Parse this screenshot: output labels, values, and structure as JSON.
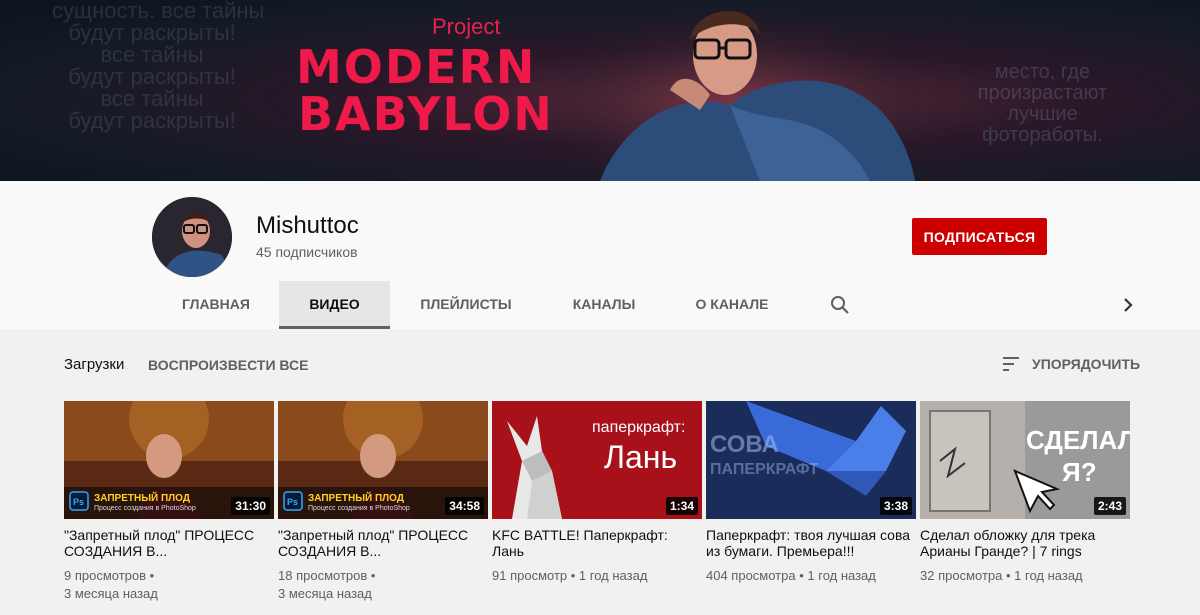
{
  "banner": {
    "project": "Project",
    "title_line1": "MODERN",
    "title_line2": "BABYLON",
    "left_text": "сущность. все тайны\nбудут раскрыты!\nвсе тайны\nбудут раскрыты!\nвсе тайны\nбудут раскрыты!",
    "right_text": "место, где\nпроизрастают\nлучшие\nфотоработы."
  },
  "channel": {
    "name": "Mishuttoc",
    "subscribers": "45 подписчиков",
    "subscribe_label": "ПОДПИСАТЬСЯ",
    "subscribe_color": "#cc0000"
  },
  "tabs": [
    {
      "label": "ГЛАВНАЯ"
    },
    {
      "label": "ВИДЕО"
    },
    {
      "label": "ПЛЕЙЛИСТЫ"
    },
    {
      "label": "КАНАЛЫ"
    },
    {
      "label": "О КАНАЛЕ"
    }
  ],
  "active_tab": "ВИДЕО",
  "section": {
    "title": "Загрузки",
    "play_all": "ВОСПРОИЗВЕСТИ ВСЕ",
    "sort_label": "УПОРЯДОЧИТЬ"
  },
  "videos": [
    {
      "title": "\"Запретный плод\" ПРОЦЕСС СОЗДАНИЯ В...",
      "duration": "31:30",
      "views": "9 просмотров",
      "age": "3 месяца назад",
      "thumb_caption": "ЗАПРЕТНЫЙ ПЛОД",
      "thumb_sub": "Процесс создания в PhotoShop"
    },
    {
      "title": "\"Запретный плод\" ПРОЦЕСС СОЗДАНИЯ В...",
      "duration": "34:58",
      "views": "18 просмотров",
      "age": "3 месяца назад",
      "thumb_caption": "ЗАПРЕТНЫЙ ПЛОД",
      "thumb_sub": "Процесс создания в PhotoShop"
    },
    {
      "title": "KFC BATTLE! Паперкрафт: Лань",
      "duration": "1:34",
      "views": "91 просмотр",
      "age": "1 год назад",
      "thumb_caption": "паперкрафт:",
      "thumb_sub": "Лань"
    },
    {
      "title": "Паперкрафт: твоя лучшая сова из бумаги. Премьера!!!",
      "duration": "3:38",
      "views": "404 просмотра",
      "age": "1 год назад",
      "thumb_caption": "СОВА",
      "thumb_sub": "ПАПЕРКРАФТ"
    },
    {
      "title": "Сделал обложку для трека Арианы Гранде? | 7 rings",
      "duration": "2:43",
      "views": "32 просмотра",
      "age": "1 год назад",
      "thumb_caption": "СДЕЛАЛ",
      "thumb_sub": "Я?"
    }
  ]
}
